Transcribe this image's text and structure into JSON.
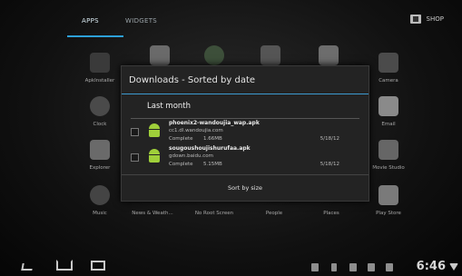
{
  "tabs": {
    "apps": "APPS",
    "widgets": "WIDGETS",
    "shop": "SHOP"
  },
  "apps": [
    {
      "label": "ApkInstaller",
      "color": "#3a3a3a"
    },
    {
      "label": "",
      "color": "#6a6a6a"
    },
    {
      "label": "",
      "color": "#3d4f3a"
    },
    {
      "label": "",
      "color": "#555555"
    },
    {
      "label": "",
      "color": "#6d6d6d"
    },
    {
      "label": "Camera",
      "color": "#4b4b4b"
    },
    {
      "label": "Clock",
      "color": "#4a4a4a"
    },
    {
      "label": "Email",
      "color": "#8a8a8a"
    },
    {
      "label": "Explorer",
      "color": "#6a6a6a"
    },
    {
      "label": "Movie Studio",
      "color": "#666666"
    },
    {
      "label": "Music",
      "color": "#444444"
    },
    {
      "label": "News & Weath...",
      "color": "#444"
    },
    {
      "label": "No Root Screen",
      "color": "#444"
    },
    {
      "label": "People",
      "color": "#444"
    },
    {
      "label": "Places",
      "color": "#444"
    },
    {
      "label": "Play Store",
      "color": "#7a7a7a"
    }
  ],
  "dialog": {
    "title": "Downloads - Sorted by date",
    "section": "Last month",
    "items": [
      {
        "name": "phoenix2-wandoujia_wap.apk",
        "host": "cc1.dl.wandoujia.com",
        "status": "Complete",
        "size": "1.66MB",
        "date": "5/18/12"
      },
      {
        "name": "sougoushoujishurufaa.apk",
        "host": "gdown.baidu.com",
        "status": "Complete",
        "size": "5.15MB",
        "date": "5/18/12"
      }
    ],
    "sort_button": "Sort by size"
  },
  "statusbar": {
    "time": "6:46"
  }
}
